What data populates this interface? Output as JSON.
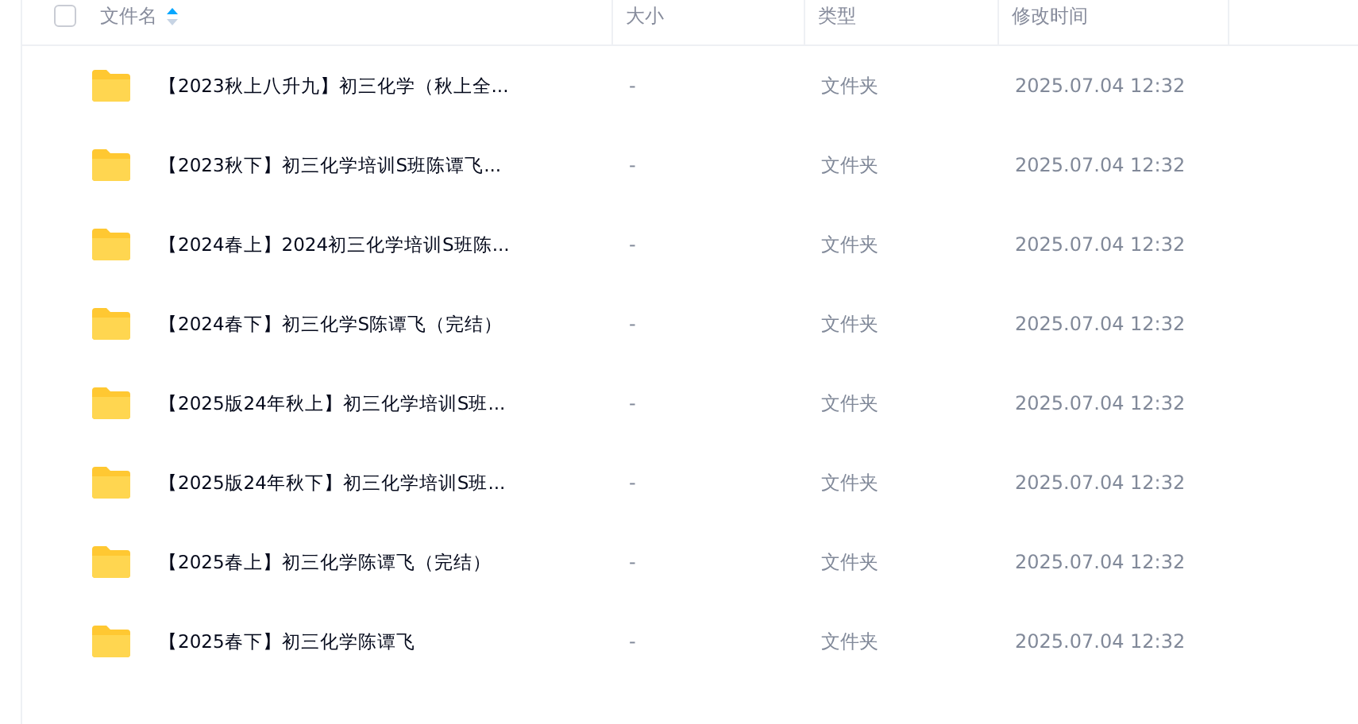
{
  "header": {
    "checked": false,
    "columns": [
      {
        "label": "文件名",
        "sortable": true
      },
      {
        "label": "大小",
        "sortable": false
      },
      {
        "label": "类型",
        "sortable": false
      },
      {
        "label": "修改时间",
        "sortable": false
      }
    ]
  },
  "files": [
    {
      "name": "【2023秋上八升九】初三化学（秋上全...",
      "size": "-",
      "type": "文件夹",
      "modified": "2025.07.04 12:32"
    },
    {
      "name": "【2023秋下】初三化学培训S班陈谭飞...",
      "size": "-",
      "type": "文件夹",
      "modified": "2025.07.04 12:32"
    },
    {
      "name": "【2024春上】2024初三化学培训S班陈...",
      "size": "-",
      "type": "文件夹",
      "modified": "2025.07.04 12:32"
    },
    {
      "name": "【2024春下】初三化学S陈谭飞（完结）",
      "size": "-",
      "type": "文件夹",
      "modified": "2025.07.04 12:32"
    },
    {
      "name": "【2025版24年秋上】初三化学培训S班...",
      "size": "-",
      "type": "文件夹",
      "modified": "2025.07.04 12:32"
    },
    {
      "name": "【2025版24年秋下】初三化学培训S班...",
      "size": "-",
      "type": "文件夹",
      "modified": "2025.07.04 12:32"
    },
    {
      "name": "【2025春上】初三化学陈谭飞（完结）",
      "size": "-",
      "type": "文件夹",
      "modified": "2025.07.04 12:32"
    },
    {
      "name": "【2025春下】初三化学陈谭飞",
      "size": "-",
      "type": "文件夹",
      "modified": "2025.07.04 12:32"
    }
  ]
}
